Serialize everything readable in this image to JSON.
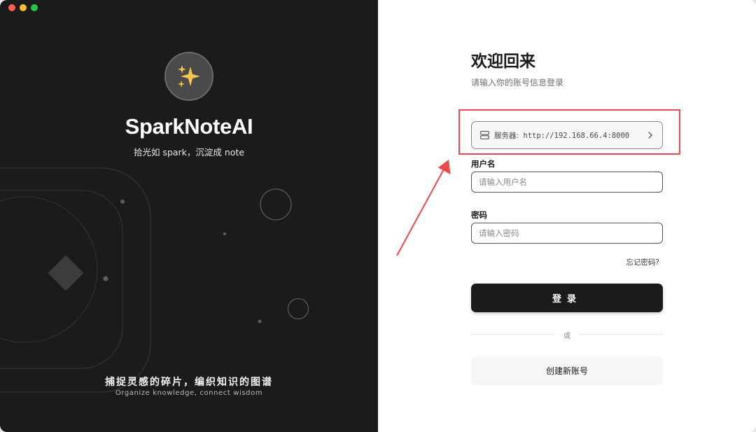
{
  "window": {
    "traffic_lights": [
      "close",
      "minimize",
      "maximize"
    ]
  },
  "brand": {
    "logo_icon": "sparkles-icon",
    "app_name": "SparkNoteAI",
    "subtitle": "拾光如 spark，沉淀成 note",
    "tagline": "捕捉灵感的碎片，编织知识的图谱",
    "tagline_en": "Organize knowledge, connect wisdom"
  },
  "login": {
    "title": "欢迎回来",
    "subtitle": "请输入你的账号信息登录",
    "server": {
      "icon": "server-icon",
      "label": "服务器:",
      "url": "http://192.168.66.4:8000",
      "chevron": "chevron-right-icon"
    },
    "username": {
      "label": "用户名",
      "placeholder": "请输入用户名",
      "value": ""
    },
    "password": {
      "label": "密码",
      "placeholder": "请输入密码",
      "value": ""
    },
    "forgot": "忘记密码?",
    "submit": "登录",
    "or": "或",
    "create_account": "创建新账号"
  },
  "annotation": {
    "highlight_color": "#ea4a4f"
  }
}
